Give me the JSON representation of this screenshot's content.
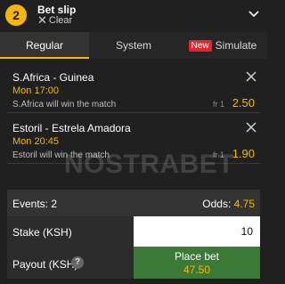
{
  "header": {
    "count": "2",
    "title": "Bet slip",
    "clear_label": "Clear"
  },
  "tabs": [
    {
      "label": "Regular",
      "active": true
    },
    {
      "label": "System",
      "active": false
    },
    {
      "badge": "New",
      "label": "Simulate",
      "active": false
    }
  ],
  "bets": [
    {
      "event": "S.Africa - Guinea",
      "time": "Mon 17:00",
      "market": "S.Africa will win the match",
      "type": "fr 1",
      "odds": "2.50"
    },
    {
      "event": "Estoril - Estrela Amadora",
      "time": "Mon 20:45",
      "market": "Estoril will win the match",
      "type": "fr 1",
      "odds": "1.90"
    }
  ],
  "watermark": "NOSTRABET",
  "summary": {
    "events_label": "Events: 2",
    "odds_label": "Odds:",
    "odds_value": "4.75",
    "stake_label": "Stake (KSH)",
    "stake_value": "10",
    "payout_label": "Payout (KSH)",
    "place_label": "Place bet",
    "place_amount": "47.50"
  },
  "colors": {
    "accent": "#f5b800",
    "background": "#202020",
    "place_bet": "#3a7a36",
    "new_badge": "#e3262c"
  }
}
